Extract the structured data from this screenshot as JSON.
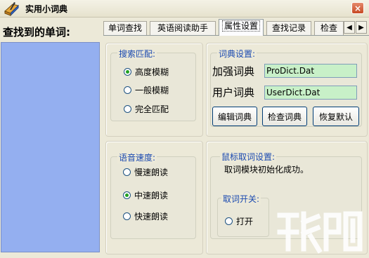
{
  "window": {
    "title": "实用小词典",
    "close_label": "×"
  },
  "left": {
    "found_label": "查找到的单词:"
  },
  "tabs": [
    {
      "label": "单词查找"
    },
    {
      "label": "英语阅读助手"
    },
    {
      "label": "属性设置"
    },
    {
      "label": "查找记录"
    },
    {
      "label": "检查"
    }
  ],
  "tab_scroll": {
    "left": "◀",
    "right": "▶"
  },
  "search": {
    "group_label": "搜索匹配:",
    "options": [
      "高度模糊",
      "一般模糊",
      "完全匹配"
    ],
    "selected": 0
  },
  "dict": {
    "group_label": "词典设置:",
    "enhance_label": "加强词典",
    "enhance_value": "ProDict.Dat",
    "user_label": "用户词典",
    "user_value": "UserDict.Dat",
    "buttons": [
      "编辑词典",
      "检查词典",
      "恢复默认"
    ]
  },
  "speech": {
    "group_label": "语音速度:",
    "options": [
      "慢速朗读",
      "中速朗读",
      "快速朗读"
    ],
    "selected": 1
  },
  "mouse": {
    "group_label": "鼠标取词设置:",
    "status": "取词模块初始化成功。",
    "switch_label": "取词开关:",
    "switch_option": "打开"
  }
}
